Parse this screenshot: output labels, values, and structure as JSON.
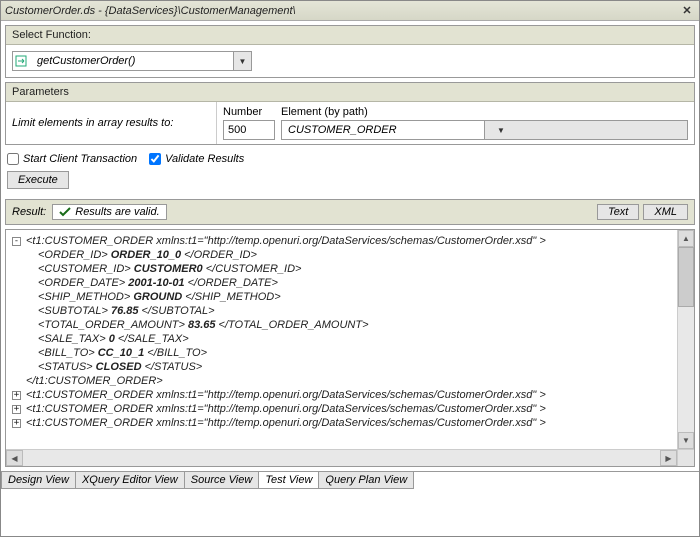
{
  "title": "CustomerOrder.ds - {DataServices}\\CustomerManagement\\",
  "sections": {
    "select_function": "Select Function:",
    "parameters": "Parameters"
  },
  "function_name": "getCustomerOrder()",
  "limit_label": "Limit elements in array results to:",
  "number_label": "Number",
  "element_label": "Element (by path)",
  "number_value": "500",
  "element_value": "CUSTOMER_ORDER",
  "checks": {
    "start_client": "Start Client Transaction",
    "validate": "Validate Results",
    "start_client_checked": false,
    "validate_checked": true
  },
  "execute_label": "Execute",
  "result_label": "Result:",
  "valid_text": "Results are valid.",
  "toggle_text": "Text",
  "toggle_xml": "XML",
  "xml_ns": "http://temp.openuri.org/DataServices/schemas/CustomerOrder.xsd",
  "record": {
    "ORDER_ID": "ORDER_10_0",
    "CUSTOMER_ID": "CUSTOMER0",
    "ORDER_DATE": "2001-10-01",
    "SHIP_METHOD": "GROUND",
    "SUBTOTAL": "76.85",
    "TOTAL_ORDER_AMOUNT": "83.65",
    "SALE_TAX": "0",
    "BILL_TO": "CC_10_1",
    "STATUS": "CLOSED"
  },
  "tabs": [
    "Design View",
    "XQuery Editor View",
    "Source View",
    "Test View",
    "Query Plan View"
  ],
  "active_tab": "Test View"
}
